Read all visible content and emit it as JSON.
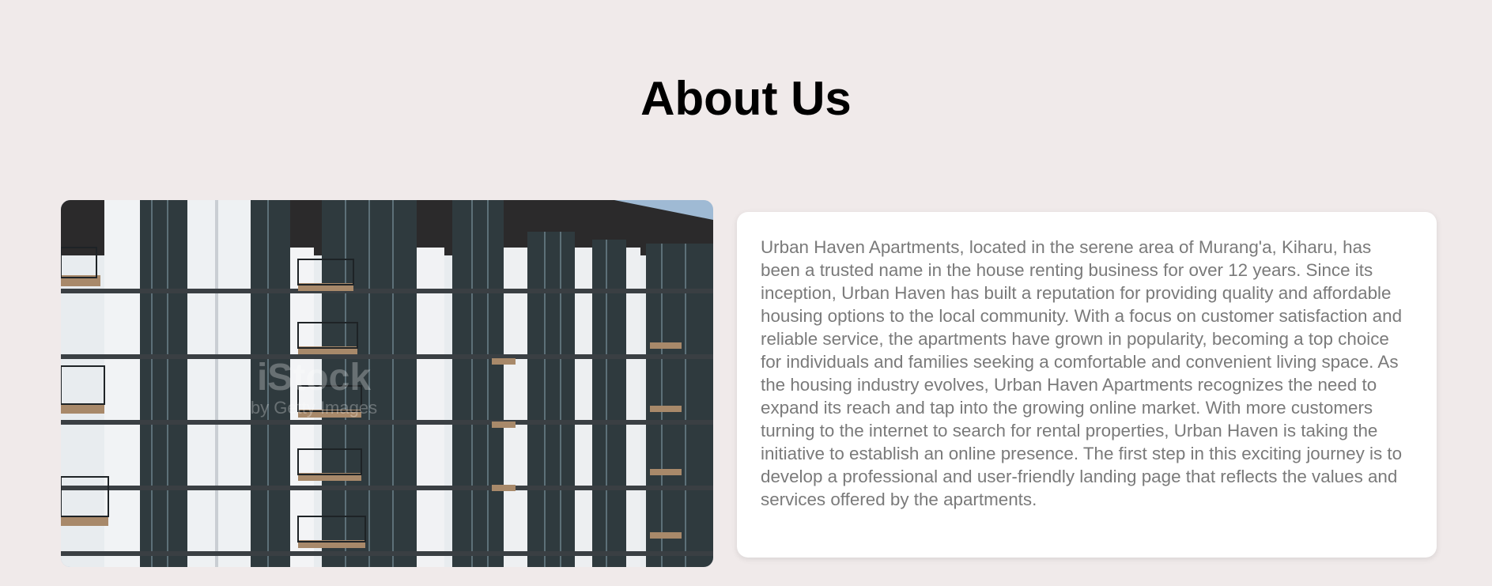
{
  "section": {
    "title": "About Us"
  },
  "image": {
    "alt": "Apartment building exterior",
    "watermark_main": "iStock",
    "watermark_sub": "by Getty Images"
  },
  "about": {
    "text": "Urban Haven Apartments, located in the serene area of Murang'a, Kiharu, has been a trusted name in the house renting business for over 12 years. Since its inception, Urban Haven has built a reputation for providing quality and affordable housing options to the local community. With a focus on customer satisfaction and reliable service, the apartments have grown in popularity, becoming a top choice for individuals and families seeking a comfortable and convenient living space. As the housing industry evolves, Urban Haven Apartments recognizes the need to expand its reach and tap into the growing online market. With more customers turning to the internet to search for rental properties, Urban Haven is taking the initiative to establish an online presence. The first step in this exciting journey is to develop a professional and user-friendly landing page that reflects the values and services offered by the apartments."
  },
  "colors": {
    "background": "#f0eaea",
    "card": "#ffffff",
    "body_text": "#7a7a7a",
    "title_text": "#000000"
  }
}
